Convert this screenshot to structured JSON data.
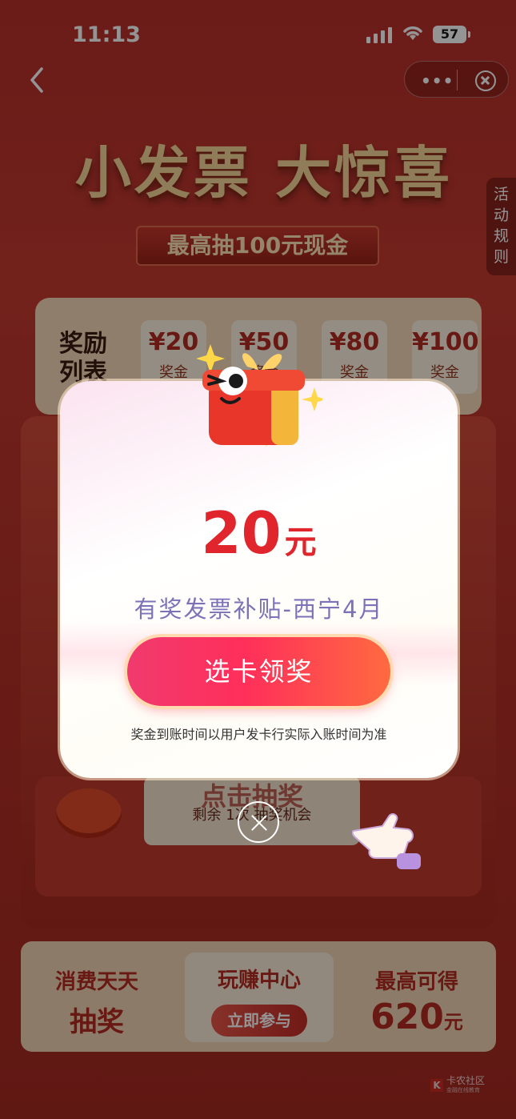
{
  "status_bar": {
    "time": "11:13",
    "battery": "57"
  },
  "nav": {
    "more_icon": "more-dots-icon",
    "close_icon": "close-circle-icon",
    "back_icon": "chevron-left-icon"
  },
  "hero": {
    "title": "小发票 大惊喜",
    "subtitle": "最高抽100元现金"
  },
  "rules_tab": {
    "label": "活动规则"
  },
  "reward_list": {
    "label": "奖励列表",
    "items": [
      {
        "amount": "¥20",
        "label": "奖金"
      },
      {
        "amount": "¥50",
        "label": "奖金"
      },
      {
        "amount": "¥80",
        "label": "奖金"
      },
      {
        "amount": "¥100",
        "label": "奖金"
      }
    ]
  },
  "machine": {
    "draw_label": "点击抽奖",
    "chances": "剩余 1次 抽奖机会"
  },
  "bottom_bar": {
    "left_line1": "消费天天",
    "left_line2": "抽奖",
    "mid_title": "玩赚中心",
    "mid_button": "立即参与",
    "right_line1": "最高可得",
    "right_amount": "620",
    "right_unit": "元"
  },
  "modal": {
    "amount": "20",
    "unit": "元",
    "prize_name": "有奖发票补贴-西宁4月",
    "claim_button": "选卡领奖",
    "notice": "奖金到账时间以用户发卡行实际入账时间为准"
  },
  "watermark": {
    "text": "卡农社区",
    "subtext": "金融在线教育"
  },
  "colors": {
    "accent_red": "#e0252d",
    "button_pink": "#ff2f5a",
    "prize_name": "#7b72b8"
  }
}
